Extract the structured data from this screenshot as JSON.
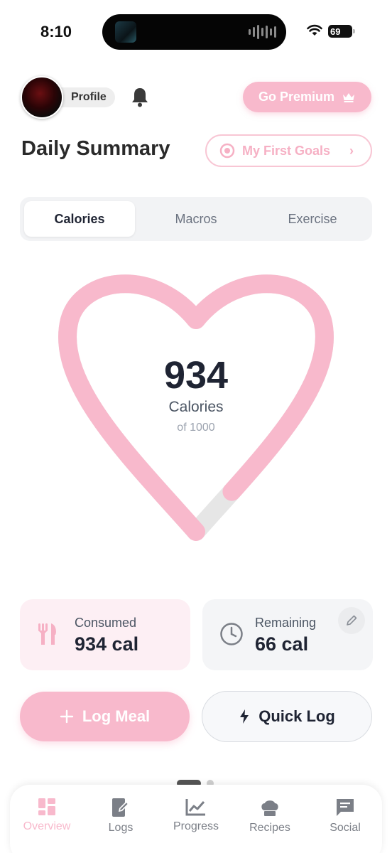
{
  "status_bar": {
    "time": "8:10",
    "battery": "69"
  },
  "header": {
    "profile_label": "Profile",
    "premium_label": "Go Premium",
    "title": "Daily Summary",
    "goals_label": "My First Goals"
  },
  "tabs": [
    {
      "label": "Calories",
      "active": true
    },
    {
      "label": "Macros",
      "active": false
    },
    {
      "label": "Exercise",
      "active": false
    }
  ],
  "calories": {
    "value": "934",
    "label": "Calories",
    "goal_text": "of 1000",
    "progress": 0.934
  },
  "cards": {
    "consumed": {
      "label": "Consumed",
      "value": "934 cal"
    },
    "remaining": {
      "label": "Remaining",
      "value": "66 cal"
    }
  },
  "actions": {
    "log_meal": "Log Meal",
    "quick_log": "Quick Log"
  },
  "nav": [
    {
      "label": "Overview",
      "icon": "dashboard-icon",
      "active": true
    },
    {
      "label": "Logs",
      "icon": "journal-edit-icon",
      "active": false
    },
    {
      "label": "Progress",
      "icon": "chart-icon",
      "active": false
    },
    {
      "label": "Recipes",
      "icon": "chef-hat-icon",
      "active": false
    },
    {
      "label": "Social",
      "icon": "chat-icon",
      "active": false
    }
  ],
  "colors": {
    "accent": "#f8b9cc",
    "accent_text": "#f6b0c4",
    "track": "#e6e6e6",
    "text": "#1f2433"
  }
}
